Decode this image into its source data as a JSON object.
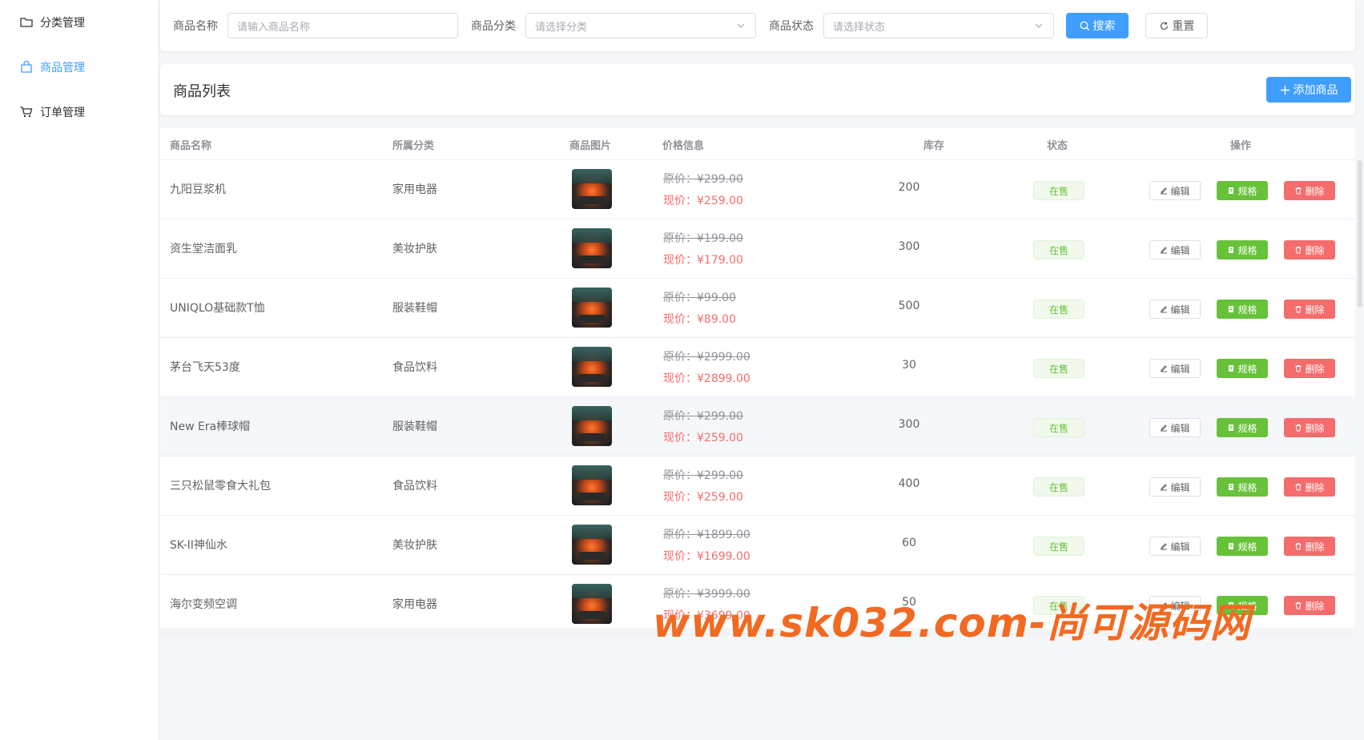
{
  "sidebar": {
    "items": [
      {
        "label": "分类管理",
        "icon": "folder-icon",
        "active": false
      },
      {
        "label": "商品管理",
        "icon": "shopping-bag-icon",
        "active": true
      },
      {
        "label": "订单管理",
        "icon": "cart-icon",
        "active": false
      }
    ]
  },
  "filters": {
    "name_label": "商品名称",
    "name_placeholder": "请输入商品名称",
    "category_label": "商品分类",
    "category_placeholder": "请选择分类",
    "status_label": "商品状态",
    "status_placeholder": "请选择状态",
    "search_label": "搜索",
    "reset_label": "重置"
  },
  "list": {
    "title": "商品列表",
    "add_label": "添加商品"
  },
  "table": {
    "columns": [
      "商品名称",
      "所属分类",
      "商品图片",
      "价格信息",
      "库存",
      "状态",
      "操作"
    ],
    "rows": [
      {
        "name": "九阳豆浆机",
        "category": "家用电器",
        "original": "原价：¥299.00",
        "current": "现价：¥259.00",
        "stock": "200",
        "status": "在售"
      },
      {
        "name": "资生堂洁面乳",
        "category": "美妆护肤",
        "original": "原价：¥199.00",
        "current": "现价：¥179.00",
        "stock": "300",
        "status": "在售"
      },
      {
        "name": "UNIQLO基础款T恤",
        "category": "服装鞋帽",
        "original": "原价：¥99.00",
        "current": "现价：¥89.00",
        "stock": "500",
        "status": "在售"
      },
      {
        "name": "茅台飞天53度",
        "category": "食品饮料",
        "original": "原价：¥2999.00",
        "current": "现价：¥2899.00",
        "stock": "30",
        "status": "在售"
      },
      {
        "name": "New Era棒球帽",
        "category": "服装鞋帽",
        "original": "原价：¥299.00",
        "current": "现价：¥259.00",
        "stock": "300",
        "status": "在售"
      },
      {
        "name": "三只松鼠零食大礼包",
        "category": "食品饮料",
        "original": "原价：¥299.00",
        "current": "现价：¥259.00",
        "stock": "400",
        "status": "在售"
      },
      {
        "name": "SK-II神仙水",
        "category": "美妆护肤",
        "original": "原价：¥1899.00",
        "current": "现价：¥1699.00",
        "stock": "60",
        "status": "在售"
      },
      {
        "name": "海尔变频空调",
        "category": "家用电器",
        "original": "原价：¥3999.00",
        "current": "现价：¥3699.00",
        "stock": "50",
        "status": "在售"
      }
    ],
    "actions": {
      "edit": "编辑",
      "spec": "规格",
      "delete": "删除"
    }
  },
  "watermark": "www.sk032.com-尚可源码网",
  "colors": {
    "primary": "#409eff",
    "success": "#67c23a",
    "danger": "#f56c6c",
    "watermark": "#f26a21"
  }
}
